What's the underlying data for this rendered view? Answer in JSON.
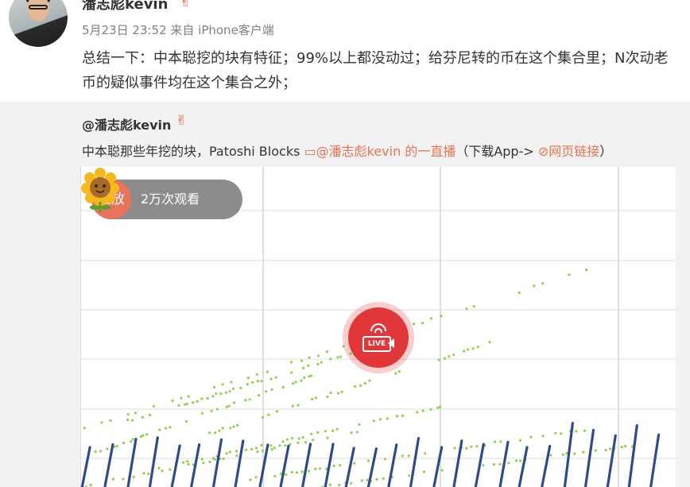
{
  "post": {
    "username": "潘志彪kevin",
    "badge_icon": "celebrity-badge-icon",
    "meta": "5月23日 23:52 来自 iPhone客户端",
    "text": "总结一下：中本聪挖的块有特征；99%以上都没动过；给芬尼转的币在这个集合里；N次动老币的疑似事件均在这个集合之外；"
  },
  "repost": {
    "mention": "@潘志彪kevin",
    "text_before": "中本聪那些年挖的块，Patoshi Blocks ",
    "live_link": "@潘志彪kevin 的一直播",
    "text_mid": "（下载App-> ",
    "web_link": "网页链接",
    "text_after": "）"
  },
  "video": {
    "replay_label": "回放",
    "views": "2万次观看",
    "live_label": "LIVE"
  },
  "colors": {
    "link": "#eb7350",
    "blue_series": "#2e4a8c",
    "green_series": "#8fd14f",
    "live_red": "#e0383a"
  }
}
